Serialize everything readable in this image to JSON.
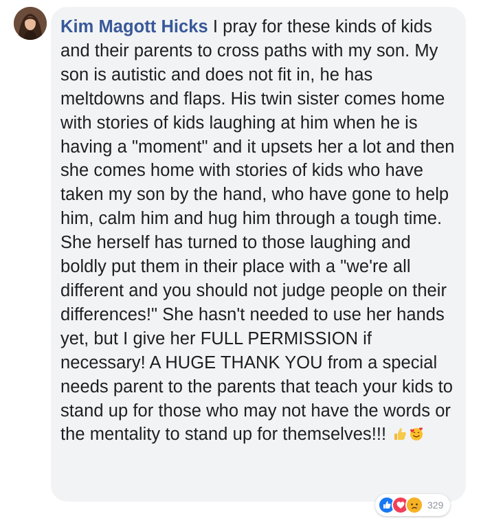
{
  "comment": {
    "author": "Kim Magott Hicks",
    "text": "I pray for these kinds of kids and their parents to cross paths with my son. My son is autistic and does not fit in, he has meltdowns and flaps. His twin sister comes home with stories of kids laughing at him when he is having a \"moment\" and it upsets her a lot and then she comes home with stories of kids who have taken my son by the hand, who have gone to help him, calm him and hug him through a tough time. She herself has turned to those laughing and boldly put them in their place with a \"we're all different and you should not judge people on their differences!\" She hasn't needed to use her hands yet, but I give her FULL PERMISSION if necessary! A HUGE THANK YOU from a special needs parent to the parents that teach your kids to stand up for those who may not have the words or the mentality to stand up for themselves!!!",
    "inline_emojis": [
      "thumbs-up-emoji",
      "smiling-face-with-hearts-emoji"
    ]
  },
  "reactions": {
    "icons": [
      "like-reaction-icon",
      "love-reaction-icon",
      "sad-reaction-icon"
    ],
    "count": "329"
  },
  "colors": {
    "author": "#385898",
    "text": "#1c1e21",
    "bubble": "#f2f3f5",
    "like": "#1877f2",
    "love": "#f33e58",
    "sad": "#f7b125"
  }
}
